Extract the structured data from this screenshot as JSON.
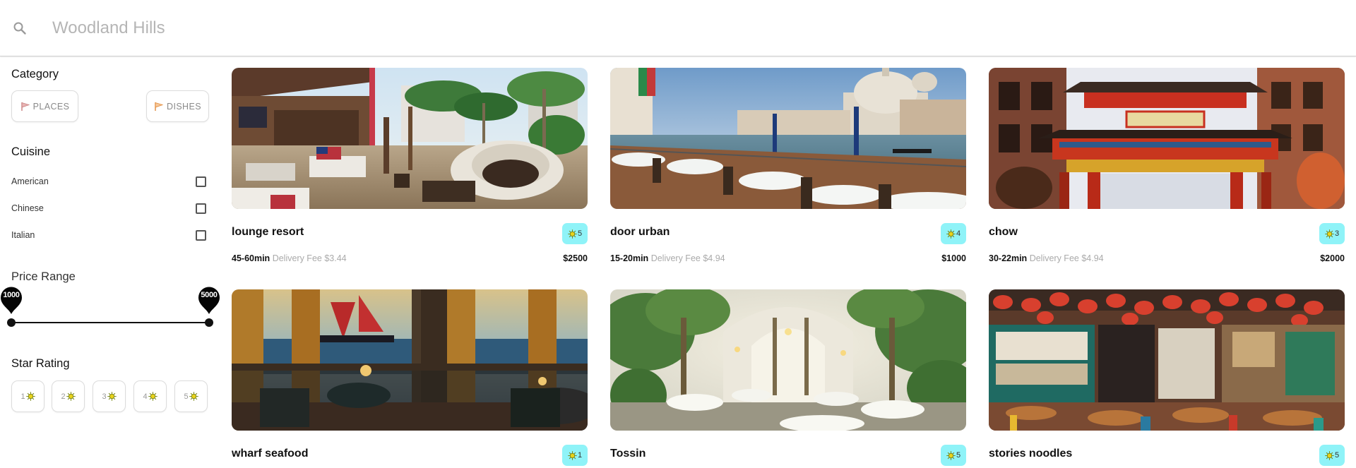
{
  "search": {
    "placeholder": "Woodland Hills",
    "icon": "search-icon"
  },
  "sidebar": {
    "category": {
      "title": "Category",
      "buttons": [
        {
          "label": "PLACES",
          "icon": "flag-icon"
        },
        {
          "label": "DISHES",
          "icon": "dish-flag-icon"
        }
      ]
    },
    "cuisine": {
      "title": "Cuisine",
      "options": [
        {
          "label": "American",
          "checked": false
        },
        {
          "label": "Chinese",
          "checked": false
        },
        {
          "label": "Italian",
          "checked": false
        }
      ]
    },
    "price_range": {
      "title": "Price Range",
      "min": "1000",
      "max": "5000"
    },
    "star_rating": {
      "title": "Star Rating",
      "options": [
        "1",
        "2",
        "3",
        "4",
        "5"
      ],
      "icon": "sun-star-icon"
    }
  },
  "restaurants": [
    {
      "name": "lounge resort",
      "rating": "5",
      "time": "45-60min",
      "fee": "Delivery Fee $3.44",
      "price": "$2500"
    },
    {
      "name": "door urban",
      "rating": "4",
      "time": "15-20min",
      "fee": "Delivery Fee $4.94",
      "price": "$1000"
    },
    {
      "name": "chow",
      "rating": "3",
      "time": "30-22min",
      "fee": "Delivery Fee $4.94",
      "price": "$2000"
    },
    {
      "name": "wharf seafood",
      "rating": "1"
    },
    {
      "name": "Tossin",
      "rating": "5"
    },
    {
      "name": "stories noodles",
      "rating": "5"
    }
  ],
  "colors": {
    "badge": "#8ff3f8",
    "accent": "#111111",
    "muted": "#aaaaaa"
  }
}
